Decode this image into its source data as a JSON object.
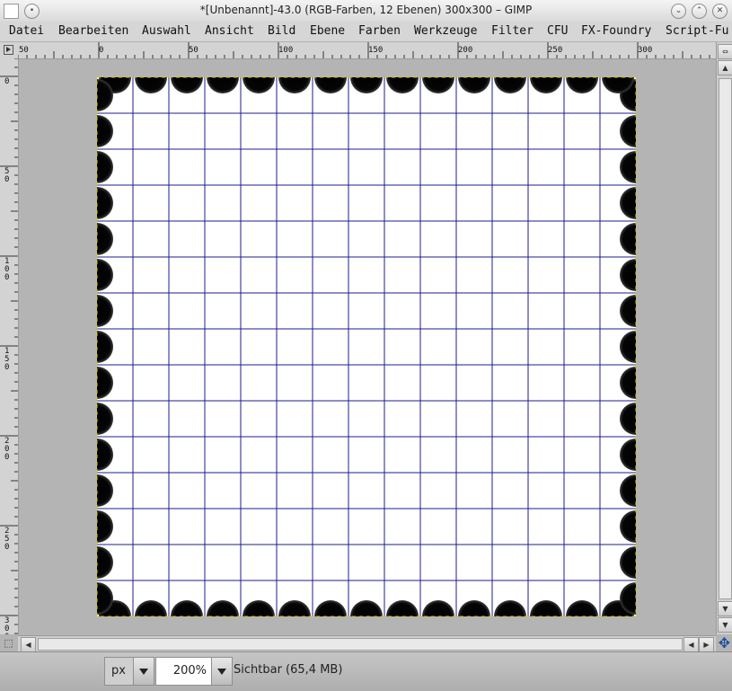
{
  "window": {
    "title": "*[Unbenannt]-43.0 (RGB-Farben, 12 Ebenen) 300x300 – GIMP"
  },
  "menu": [
    "Datei",
    "Bearbeiten",
    "Auswahl",
    "Ansicht",
    "Bild",
    "Ebene",
    "Farben",
    "Werkzeuge",
    "Filter",
    "CFU",
    "FX-Foundry",
    "Script-Fu"
  ],
  "hruler": [
    "50",
    "0",
    "50",
    "100",
    "150",
    "200",
    "250",
    "300"
  ],
  "vruler": [
    "0",
    "50",
    "100",
    "150",
    "200",
    "250",
    "300"
  ],
  "status": {
    "unit": "px",
    "zoom": "200%",
    "message": "Sichtbar (65,4 MB)"
  },
  "colors": {
    "grid": "#1c1c8c",
    "circle": "#050505",
    "workspace": "#b4b4b4"
  },
  "icons": {
    "minimize": "chevron-down-icon",
    "maximize": "chevron-up-icon",
    "close": "close-icon",
    "navigate": "navigate-cross-icon",
    "quickmask": "quickmask-icon"
  }
}
